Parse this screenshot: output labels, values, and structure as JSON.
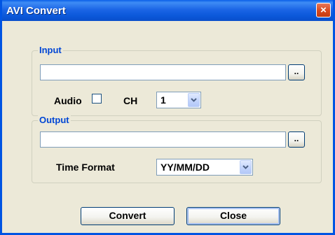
{
  "window": {
    "title": "AVI Convert",
    "close_glyph": "×"
  },
  "input_group": {
    "label": "Input",
    "path_value": "",
    "browse_label": "..",
    "audio_label": "Audio",
    "audio_checked": false,
    "channel_label": "CH",
    "channel_selected": "1"
  },
  "output_group": {
    "label": "Output",
    "path_value": "",
    "browse_label": "..",
    "time_format_label": "Time Format",
    "time_format_selected": "YY/MM/DD"
  },
  "buttons": {
    "convert_label": "Convert",
    "close_label": "Close"
  },
  "colors": {
    "title_bar": "#0A5FE8",
    "group_label": "#0046D5",
    "close_button": "#D9481C",
    "dialog_bg": "#ECE9D8"
  },
  "icons": {
    "close": "close-icon",
    "dropdown": "chevron-down-icon"
  }
}
